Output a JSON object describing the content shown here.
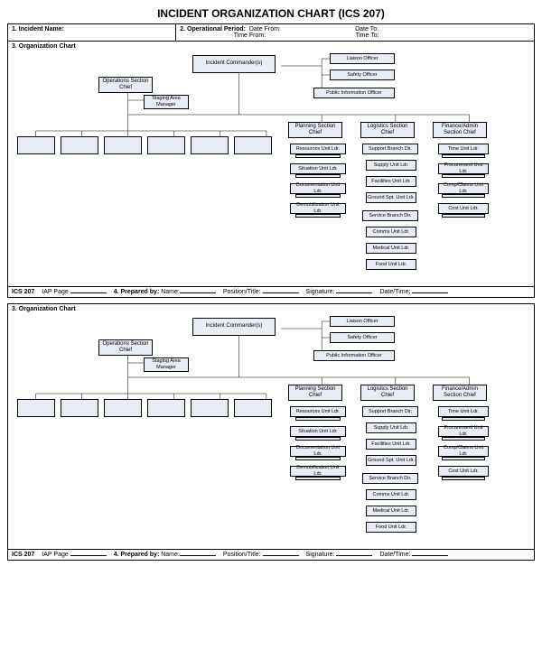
{
  "title": "INCIDENT ORGANIZATION CHART (ICS 207)",
  "header": {
    "incident_name_label": "1. Incident Name:",
    "operational_period_label": "2. Operational Period:",
    "date_from_label": "Date From:",
    "date_to_label": "Date To:",
    "time_from_label": "Time From:",
    "time_to_label": "Time To:"
  },
  "section3_label": "3. Organization Chart",
  "org": {
    "incident_commander": "Incident Commander(s)",
    "liaison": "Liaison Officer",
    "safety": "Safety Officer",
    "pio": "Public Information Officer",
    "operations_chief": "Operations Section Chief",
    "staging_area": "Staging Area Manager",
    "planning_chief": "Planning Section Chief",
    "logistics_chief": "Logistics Section Chief",
    "finance_chief": "Finance/Admin Section Chief",
    "planning_units": [
      "Resources Unit Ldr.",
      "Situation Unit Ldr.",
      "Documentation Unit Ldr.",
      "Demobilization Unit Ldr."
    ],
    "logistics_units": [
      "Support Branch Dir.",
      "Supply Unit Ldr.",
      "Facilities Unit Ldr.",
      "Ground Spt. Unit Ldr.",
      "Service Branch Dir.",
      "Comms Unit Ldr.",
      "Medical Unit Ldr.",
      "Food Unit Ldr."
    ],
    "finance_units": [
      "Time Unit Ldr.",
      "Procurement Unit Ldr.",
      "Comp/Claims Unit Ldr.",
      "Cost Unit Ldr."
    ]
  },
  "footer": {
    "ics": "ICS 207",
    "iap_page": "IAP Page",
    "prepared_by": "4. Prepared by:",
    "name": "Name:",
    "position": "Position/Title:",
    "signature": "Signature:",
    "datetime": "Date/Time:"
  }
}
